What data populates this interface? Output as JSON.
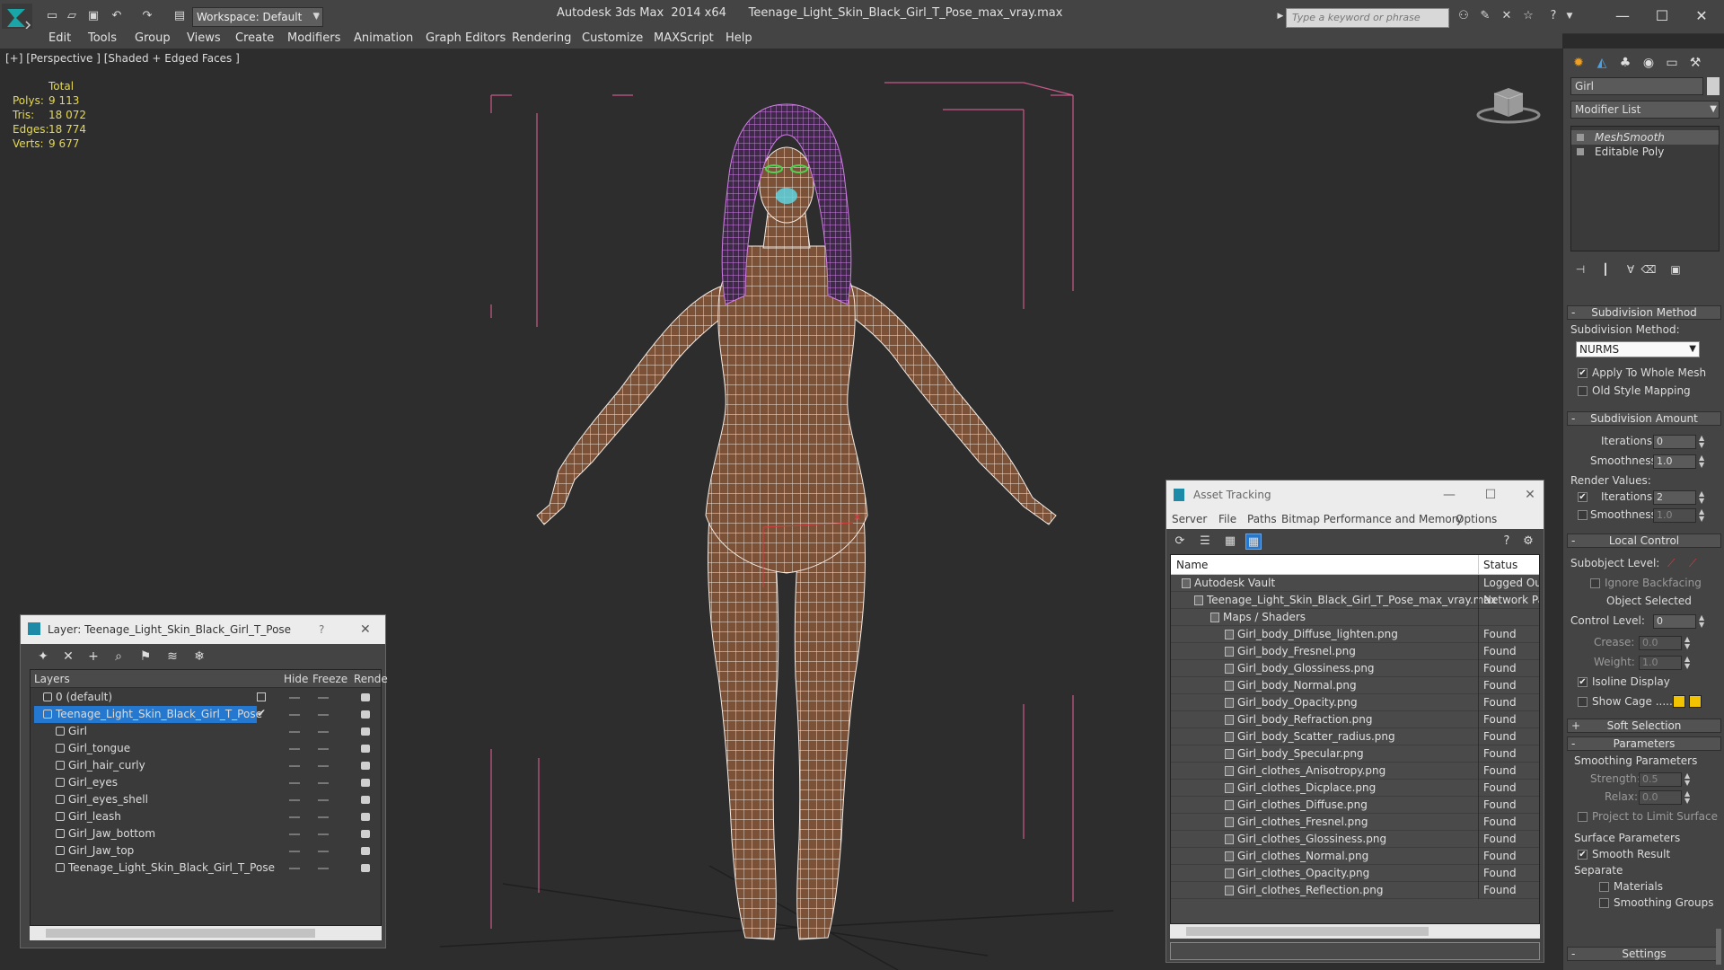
{
  "titlebar": {
    "app_title": "Autodesk 3ds Max  2014 x64      Teenage_Light_Skin_Black_Girl_T_Pose_max_vray.max",
    "workspace": "Workspace: Default",
    "search_placeholder": "Type a keyword or phrase"
  },
  "menu": [
    "Edit",
    "Tools",
    "Group",
    "Views",
    "Create",
    "Modifiers",
    "Animation",
    "Graph Editors",
    "Rendering",
    "Customize",
    "MAXScript",
    "Help"
  ],
  "viewport": {
    "label": "[+] [Perspective ] [Shaded + Edged Faces ]",
    "stats": {
      "total": "Total",
      "rows": [
        {
          "k": "Polys:",
          "v": "9 113"
        },
        {
          "k": "Tris:",
          "v": "18 072"
        },
        {
          "k": "Edges:",
          "v": "18 774"
        },
        {
          "k": "Verts:",
          "v": "9 677"
        }
      ]
    }
  },
  "layer_window": {
    "title": "Layer: Teenage_Light_Skin_Black_Girl_T_Pose",
    "help": "?",
    "close": "✕",
    "columns": {
      "layers": "Layers",
      "hide": "Hide",
      "freeze": "Freeze",
      "render": "Rende"
    },
    "rows": [
      {
        "name": "0 (default)",
        "level": 0
      },
      {
        "name": "Teenage_Light_Skin_Black_Girl_T_Pose",
        "level": 0,
        "selected": true
      },
      {
        "name": "Girl",
        "level": 1
      },
      {
        "name": "Girl_tongue",
        "level": 1
      },
      {
        "name": "Girl_hair_curly",
        "level": 1
      },
      {
        "name": "Girl_eyes",
        "level": 1
      },
      {
        "name": "Girl_eyes_shell",
        "level": 1
      },
      {
        "name": "Girl_leash",
        "level": 1
      },
      {
        "name": "Girl_Jaw_bottom",
        "level": 1
      },
      {
        "name": "Girl_Jaw_top",
        "level": 1
      },
      {
        "name": "Teenage_Light_Skin_Black_Girl_T_Pose",
        "level": 1
      }
    ]
  },
  "asset_window": {
    "title": "Asset Tracking",
    "menu": [
      "Server",
      "File",
      "Paths",
      "Bitmap Performance and Memory",
      "Options"
    ],
    "columns": {
      "name": "Name",
      "status": "Status"
    },
    "rows": [
      {
        "name": "Autodesk Vault",
        "status": "Logged Out",
        "level": 0
      },
      {
        "name": "Teenage_Light_Skin_Black_Girl_T_Pose_max_vray.max",
        "status": "Network Pa",
        "level": 1
      },
      {
        "name": "Maps / Shaders",
        "status": "",
        "level": 2
      },
      {
        "name": "Girl_body_Diffuse_lighten.png",
        "status": "Found",
        "level": 3
      },
      {
        "name": "Girl_body_Fresnel.png",
        "status": "Found",
        "level": 3
      },
      {
        "name": "Girl_body_Glossiness.png",
        "status": "Found",
        "level": 3
      },
      {
        "name": "Girl_body_Normal.png",
        "status": "Found",
        "level": 3
      },
      {
        "name": "Girl_body_Opacity.png",
        "status": "Found",
        "level": 3
      },
      {
        "name": "Girl_body_Refraction.png",
        "status": "Found",
        "level": 3
      },
      {
        "name": "Girl_body_Scatter_radius.png",
        "status": "Found",
        "level": 3
      },
      {
        "name": "Girl_body_Specular.png",
        "status": "Found",
        "level": 3
      },
      {
        "name": "Girl_clothes_Anisotropy.png",
        "status": "Found",
        "level": 3
      },
      {
        "name": "Girl_clothes_Dicplace.png",
        "status": "Found",
        "level": 3
      },
      {
        "name": "Girl_clothes_Diffuse.png",
        "status": "Found",
        "level": 3
      },
      {
        "name": "Girl_clothes_Fresnel.png",
        "status": "Found",
        "level": 3
      },
      {
        "name": "Girl_clothes_Glossiness.png",
        "status": "Found",
        "level": 3
      },
      {
        "name": "Girl_clothes_Normal.png",
        "status": "Found",
        "level": 3
      },
      {
        "name": "Girl_clothes_Opacity.png",
        "status": "Found",
        "level": 3
      },
      {
        "name": "Girl_clothes_Reflection.png",
        "status": "Found",
        "level": 3
      }
    ]
  },
  "command_panel": {
    "object_name": "Girl",
    "modifier_list": "Modifier List",
    "stack": [
      "MeshSmooth",
      "Editable Poly"
    ],
    "subdivision_method": {
      "title": "Subdivision Method",
      "label": "Subdivision Method:",
      "value": "NURMS",
      "apply_whole": "Apply To Whole Mesh",
      "old_style": "Old Style Mapping"
    },
    "subdivision_amount": {
      "title": "Subdivision Amount",
      "iterations_label": "Iterations:",
      "iterations": "0",
      "smoothness_label": "Smoothness:",
      "smoothness": "1.0",
      "render_values": "Render Values:",
      "r_iterations": "2",
      "r_smoothness": "1.0"
    },
    "local_control": {
      "title": "Local Control",
      "subobject": "Subobject Level:",
      "ignore_backfacing": "Ignore Backfacing",
      "object_selected": "Object Selected",
      "control_level_label": "Control Level:",
      "control_level": "0",
      "crease_label": "Crease:",
      "crease": "0.0",
      "weight_label": "Weight:",
      "weight": "1.0",
      "isoline": "Isoline Display",
      "show_cage": "Show Cage ......"
    },
    "soft_selection": "Soft Selection",
    "parameters": {
      "title": "Parameters",
      "smoothing": "Smoothing Parameters",
      "strength_label": "Strength:",
      "strength": "0.5",
      "relax_label": "Relax:",
      "relax": "0.0",
      "project": "Project to Limit Surface",
      "surface": "Surface Parameters",
      "smooth_result": "Smooth Result",
      "separate": "Separate",
      "materials": "Materials",
      "smoothing_groups": "Smoothing Groups"
    },
    "settings": "Settings"
  },
  "colors": {
    "selection": "#2478d0",
    "stats": "#e6d94c",
    "wire": "#ffffff",
    "hair": "#d17ee6",
    "bbox": "#c85a8a",
    "skin": "#7b5238"
  }
}
